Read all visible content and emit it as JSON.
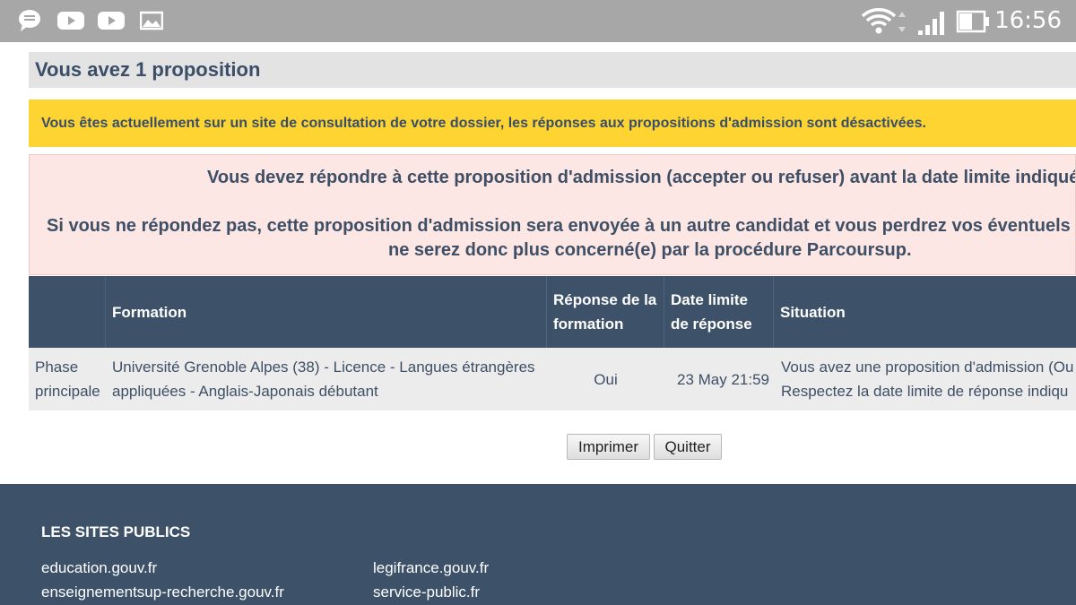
{
  "status_bar": {
    "time": "16:56",
    "left_icons": [
      "chat-bubble-icon",
      "youtube-icon",
      "youtube-icon",
      "image-icon"
    ],
    "right_icons": [
      "wifi-icon",
      "signal-icon",
      "battery-icon"
    ]
  },
  "page": {
    "title": "Vous avez 1 proposition",
    "notice": "Vous êtes actuellement sur un site de consultation de votre dossier, les réponses aux propositions d'admission sont désactivées.",
    "alert": {
      "line1": "Vous devez répondre à cette proposition d'admission (accepter ou refuser) avant la date limite indiquée",
      "line2": "Si vous ne répondez pas, cette proposition d'admission sera envoyée à un autre candidat et vous perdrez vos éventuels voe",
      "line3": "ne serez donc plus concerné(e) par la procédure Parcoursup."
    }
  },
  "table": {
    "headers": {
      "phase": "",
      "formation": "Formation",
      "reponse_line1": "Réponse de la",
      "reponse_line2": "formation",
      "date_line1": "Date limite",
      "date_line2": "de réponse",
      "situation": "Situation"
    },
    "rows": [
      {
        "phase_line1": "Phase",
        "phase_line2": "principale",
        "formation_line1": "Université Grenoble Alpes (38) - Licence - Langues étrangères",
        "formation_line2": "appliquées - Anglais-Japonais débutant",
        "reponse": "Oui",
        "date_limite": "23 May 21:59",
        "situation_line1": "Vous avez une proposition d'admission (Ou",
        "situation_line2": "Respectez la date limite de réponse indiqu"
      }
    ]
  },
  "buttons": {
    "print": "Imprimer",
    "quit": "Quitter"
  },
  "footer": {
    "title": "LES SITES PUBLICS",
    "links_col1": [
      "education.gouv.fr",
      "enseignementsup-recherche.gouv.fr"
    ],
    "links_col2": [
      "legifrance.gouv.fr",
      "service-public.fr"
    ]
  },
  "colors": {
    "status_bar": "#a7a7a7",
    "notice_bg": "#fdd431",
    "alert_bg": "#fce7e5",
    "table_header_bg": "#3d5169",
    "footer_bg": "#3d5169",
    "text": "#3e4f66"
  }
}
